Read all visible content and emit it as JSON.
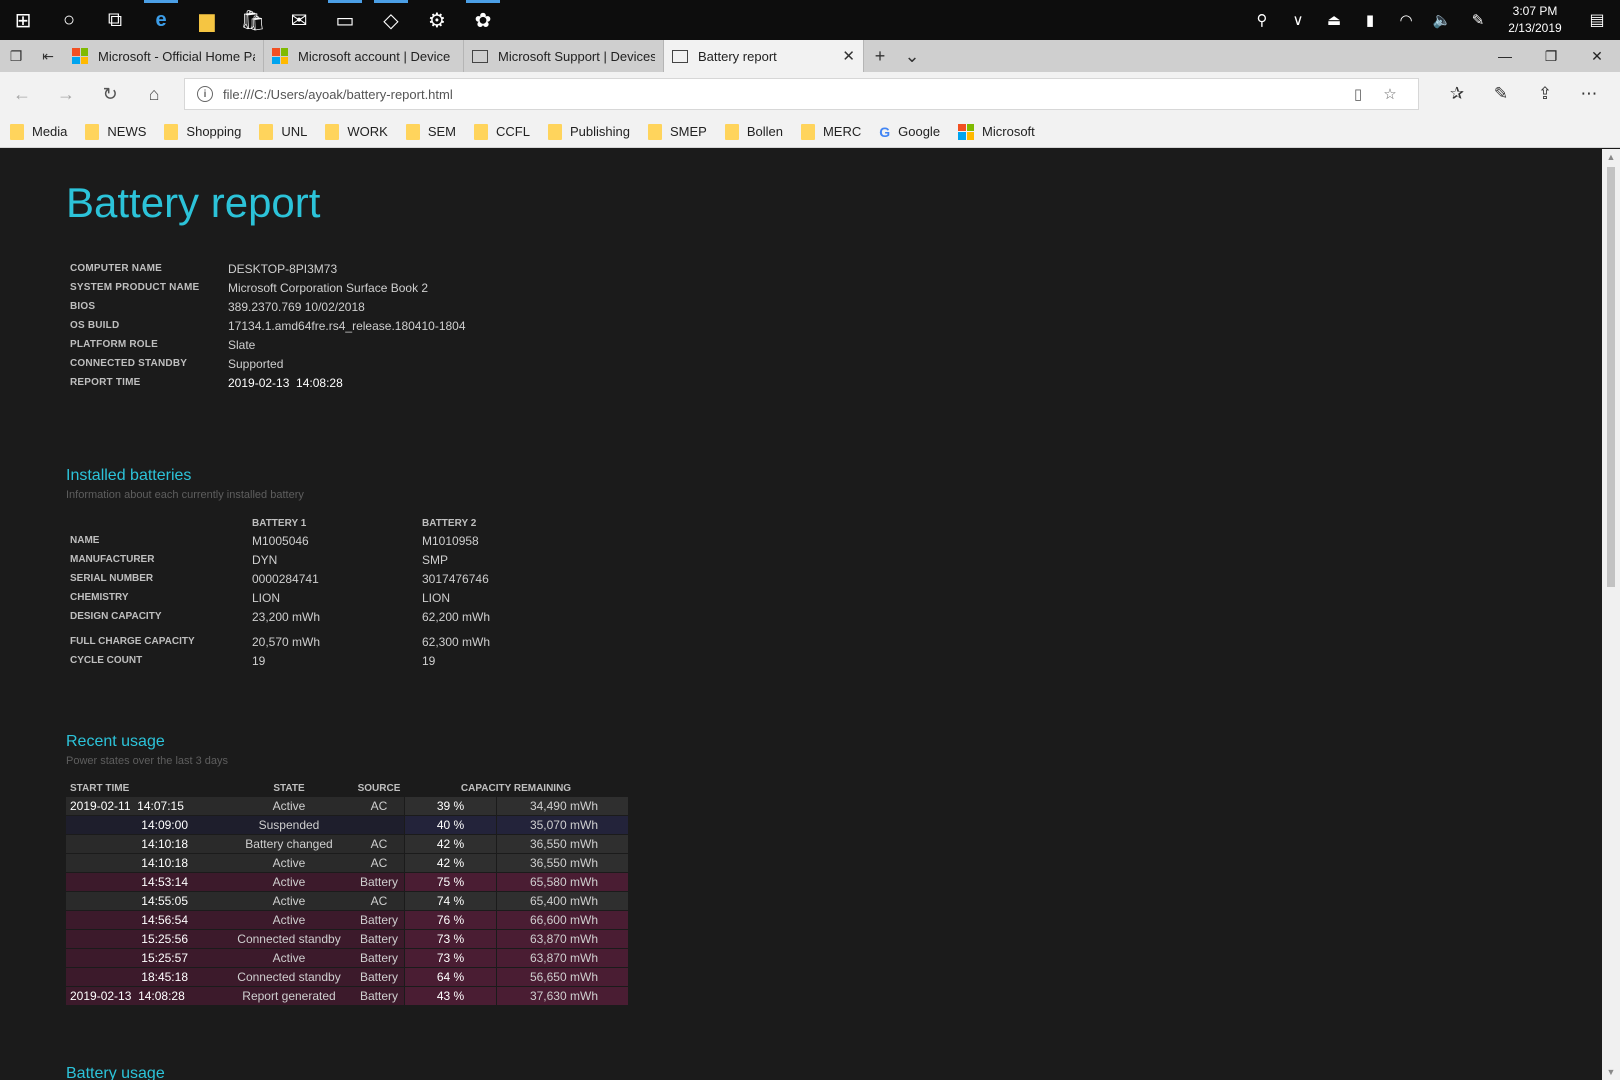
{
  "taskbar": {
    "clock_time": "3:07 PM",
    "clock_date": "2/13/2019"
  },
  "tabs": [
    {
      "label": "Microsoft - Official Home Pa",
      "icon": "microsoft-logo"
    },
    {
      "label": "Microsoft account | Device I",
      "icon": "microsoft-logo"
    },
    {
      "label": "Microsoft Support | Devices",
      "icon": "page-icon"
    },
    {
      "label": "Battery report",
      "icon": "page-icon",
      "active": true
    }
  ],
  "address": {
    "url": "file:///C:/Users/ayoak/battery-report.html"
  },
  "favorites": [
    "Media",
    "NEWS",
    "Shopping",
    "UNL",
    "WORK",
    "SEM",
    "CCFL",
    "Publishing",
    "SMEP",
    "Bollen",
    "MERC",
    "Google",
    "Microsoft"
  ],
  "report": {
    "title": "Battery report",
    "info": [
      {
        "key": "COMPUTER NAME",
        "value": "DESKTOP-8PI3M73"
      },
      {
        "key": "SYSTEM PRODUCT NAME",
        "value": "Microsoft Corporation Surface Book 2"
      },
      {
        "key": "BIOS",
        "value": "389.2370.769 10/02/2018"
      },
      {
        "key": "OS BUILD",
        "value": "17134.1.amd64fre.rs4_release.180410-1804"
      },
      {
        "key": "PLATFORM ROLE",
        "value": "Slate"
      },
      {
        "key": "CONNECTED STANDBY",
        "value": "Supported"
      },
      {
        "key": "REPORT TIME",
        "value": "2019-02-13  14:08:28"
      }
    ]
  },
  "installed": {
    "title": "Installed batteries",
    "subtitle": "Information about each currently installed battery",
    "headers": [
      "BATTERY 1",
      "BATTERY 2"
    ],
    "rows": [
      {
        "key": "NAME",
        "b1": "M1005046",
        "b2": "M1010958"
      },
      {
        "key": "MANUFACTURER",
        "b1": "DYN",
        "b2": "SMP"
      },
      {
        "key": "SERIAL NUMBER",
        "b1": "0000284741",
        "b2": "3017476746"
      },
      {
        "key": "CHEMISTRY",
        "b1": "LION",
        "b2": "LION"
      },
      {
        "key": "DESIGN CAPACITY",
        "b1": "23,200 mWh",
        "b2": "62,200 mWh"
      },
      {
        "key": "FULL CHARGE CAPACITY",
        "b1": "20,570 mWh",
        "b2": "62,300 mWh"
      },
      {
        "key": "CYCLE COUNT",
        "b1": "19",
        "b2": "19"
      }
    ]
  },
  "recent": {
    "title": "Recent usage",
    "subtitle": "Power states over the last 3 days",
    "headers": {
      "start": "START TIME",
      "state": "STATE",
      "source": "SOURCE",
      "capacity": "CAPACITY REMAINING"
    },
    "rows": [
      {
        "date": "2019-02-11",
        "time": "14:07:15",
        "state": "Active",
        "source": "AC",
        "pct": "39 %",
        "mwh": "34,490 mWh",
        "kind": "ac"
      },
      {
        "date": "",
        "time": "14:09:00",
        "state": "Suspended",
        "source": "",
        "pct": "40 %",
        "mwh": "35,070 mWh",
        "kind": "susp"
      },
      {
        "date": "",
        "time": "14:10:18",
        "state": "Battery changed",
        "source": "AC",
        "pct": "42 %",
        "mwh": "36,550 mWh",
        "kind": "ac"
      },
      {
        "date": "",
        "time": "14:10:18",
        "state": "Active",
        "source": "AC",
        "pct": "42 %",
        "mwh": "36,550 mWh",
        "kind": "ac"
      },
      {
        "date": "",
        "time": "14:53:14",
        "state": "Active",
        "source": "Battery",
        "pct": "75 %",
        "mwh": "65,580 mWh",
        "kind": "batt"
      },
      {
        "date": "",
        "time": "14:55:05",
        "state": "Active",
        "source": "AC",
        "pct": "74 %",
        "mwh": "65,400 mWh",
        "kind": "ac"
      },
      {
        "date": "",
        "time": "14:56:54",
        "state": "Active",
        "source": "Battery",
        "pct": "76 %",
        "mwh": "66,600 mWh",
        "kind": "batt"
      },
      {
        "date": "",
        "time": "15:25:56",
        "state": "Connected standby",
        "source": "Battery",
        "pct": "73 %",
        "mwh": "63,870 mWh",
        "kind": "batt"
      },
      {
        "date": "",
        "time": "15:25:57",
        "state": "Active",
        "source": "Battery",
        "pct": "73 %",
        "mwh": "63,870 mWh",
        "kind": "batt"
      },
      {
        "date": "",
        "time": "18:45:18",
        "state": "Connected standby",
        "source": "Battery",
        "pct": "64 %",
        "mwh": "56,650 mWh",
        "kind": "batt"
      },
      {
        "date": "2019-02-13",
        "time": "14:08:28",
        "state": "Report generated",
        "source": "Battery",
        "pct": "43 %",
        "mwh": "37,630 mWh",
        "kind": "batt"
      }
    ]
  },
  "battery_usage": {
    "title": "Battery usage"
  },
  "colors": {
    "accent": "#2cc3d9",
    "battery_row": "#3c1a2b",
    "ac_row": "#2a2a2a",
    "suspend_row": "#1e1e2c"
  }
}
